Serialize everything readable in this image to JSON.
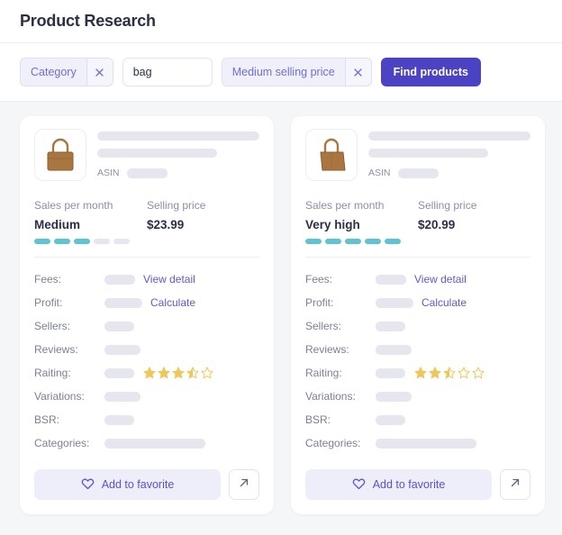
{
  "header": {
    "title": "Product Research"
  },
  "filters": {
    "chips": [
      {
        "label": "Category",
        "close_icon": "close-icon"
      },
      {
        "label": "Medium selling price",
        "close_icon": "close-icon"
      }
    ],
    "search": {
      "value": "bag",
      "placeholder": ""
    },
    "find_button": "Find products"
  },
  "colors": {
    "accent": "#4c43c4",
    "link": "#6158d0",
    "chip_bg": "#f0f0fb",
    "chip_text": "#6e6ed8",
    "bar_on": "#5ec4d4",
    "bar_off": "#e6e6ef",
    "star": "#eec75a",
    "skeleton": "#e6e6ef",
    "page_bg": "#f5f6f8"
  },
  "labels": {
    "asin": "ASIN",
    "sales_per_month": "Sales per month",
    "selling_price": "Selling price",
    "fees": "Fees:",
    "profit": "Profit:",
    "sellers": "Sellers:",
    "reviews": "Reviews:",
    "raiting": "Raiting:",
    "variations": "Variations:",
    "bsr": "BSR:",
    "categories": "Categories:",
    "view_detail": "View detail",
    "calculate": "Calculate",
    "add_to_favorite": "Add to favorite"
  },
  "cards": [
    {
      "thumbnail": "handbag-image",
      "sales_per_month": "Medium",
      "sales_level": 3,
      "sales_level_max": 5,
      "selling_price": "$23.99",
      "rating": 3.5,
      "rating_max": 5
    },
    {
      "thumbnail": "handbag-image",
      "sales_per_month": "Very high",
      "sales_level": 5,
      "sales_level_max": 5,
      "selling_price": "$20.99",
      "rating": 2.5,
      "rating_max": 5
    }
  ]
}
